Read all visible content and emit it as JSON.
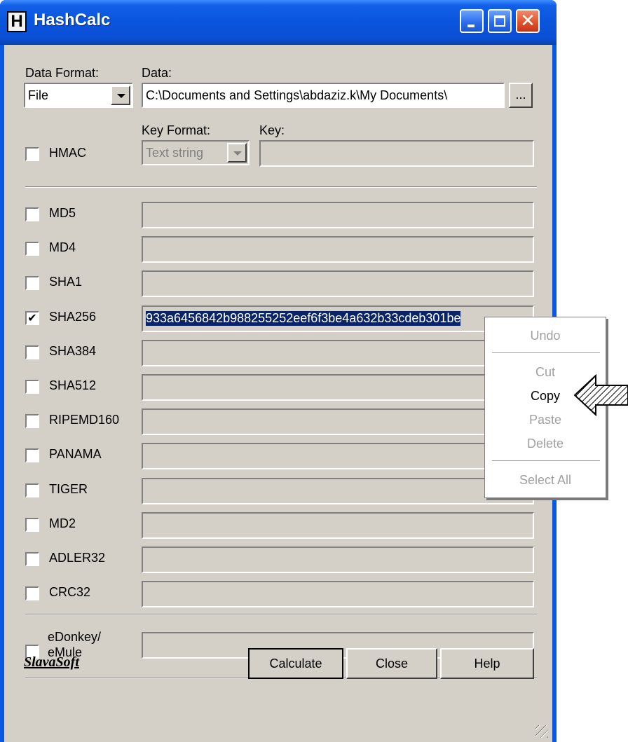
{
  "window": {
    "title": "HashCalc",
    "icon_letter": "H"
  },
  "data_format": {
    "label": "Data Format:",
    "value": "File"
  },
  "data": {
    "label": "Data:",
    "value": "C:\\Documents and Settings\\abdaziz.k\\My Documents\\",
    "browse_label": "..."
  },
  "hmac": {
    "label": "HMAC",
    "checked": false,
    "key_format_label": "Key Format:",
    "key_format_value": "Text string",
    "key_label": "Key:",
    "key_value": ""
  },
  "hashes": [
    {
      "label": "MD5",
      "checked": false,
      "value": ""
    },
    {
      "label": "MD4",
      "checked": false,
      "value": ""
    },
    {
      "label": "SHA1",
      "checked": false,
      "value": ""
    },
    {
      "label": "SHA256",
      "checked": true,
      "value": "933a6456842b988255252eef6f3be4a632b33cdeb301be"
    },
    {
      "label": "SHA384",
      "checked": false,
      "value": ""
    },
    {
      "label": "SHA512",
      "checked": false,
      "value": ""
    },
    {
      "label": "RIPEMD160",
      "checked": false,
      "value": ""
    },
    {
      "label": "PANAMA",
      "checked": false,
      "value": ""
    },
    {
      "label": "TIGER",
      "checked": false,
      "value": ""
    },
    {
      "label": "MD2",
      "checked": false,
      "value": ""
    },
    {
      "label": "ADLER32",
      "checked": false,
      "value": ""
    },
    {
      "label": "CRC32",
      "checked": false,
      "value": ""
    }
  ],
  "edonkey": {
    "label_line1": "eDonkey/",
    "label_line2": "eMule",
    "checked": false,
    "value": ""
  },
  "footer": {
    "logo": "SlavaSoft",
    "calculate": "Calculate",
    "close": "Close",
    "help": "Help"
  },
  "context_menu": {
    "items": [
      {
        "label": "Undo",
        "enabled": false
      },
      {
        "label": "Cut",
        "enabled": false
      },
      {
        "label": "Copy",
        "enabled": true
      },
      {
        "label": "Paste",
        "enabled": false
      },
      {
        "label": "Delete",
        "enabled": false
      },
      {
        "label": "Select All",
        "enabled": false
      }
    ]
  },
  "colors": {
    "titlebar": "#0a54dc",
    "dialog_face": "#d4d0c8",
    "selection": "#0a246a"
  }
}
